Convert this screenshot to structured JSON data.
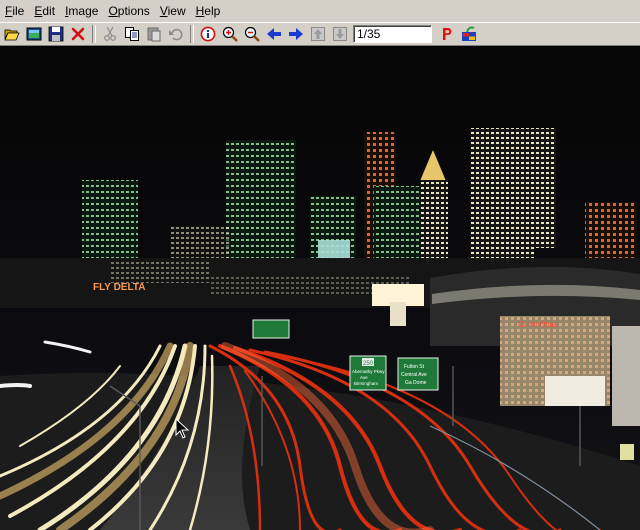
{
  "menu": {
    "file": {
      "accel": "F",
      "rest": "ile"
    },
    "edit": {
      "accel": "E",
      "rest": "dit"
    },
    "image": {
      "accel": "I",
      "rest": "mage"
    },
    "options": {
      "accel": "O",
      "rest": "ptions"
    },
    "view": {
      "accel": "V",
      "rest": "iew"
    },
    "help": {
      "accel": "H",
      "rest": "elp"
    }
  },
  "toolbar": {
    "counter": "1/35",
    "icons": [
      "open-folder-icon",
      "thumbnails-icon",
      "save-icon",
      "delete-icon",
      "cut-icon",
      "copy-icon",
      "paste-icon",
      "undo-icon",
      "info-icon",
      "zoom-in-icon",
      "zoom-out-icon",
      "previous-arrow-icon",
      "next-arrow-icon",
      "first-icon",
      "last-icon",
      "p-icon",
      "slideshow-icon"
    ]
  },
  "photo": {
    "signs": {
      "fly_delta": "FLY DELTA",
      "hotel_neon": "Omni Hotel",
      "exit_number": "250",
      "sign1_line1": "Abernathy Pkwy",
      "sign1_line2": "Ave",
      "sign1_line3": "Birmingham",
      "sign2_line1": "Fulton St",
      "sign2_line2": "Central Ave",
      "sign2_line3": "Ga Dome"
    }
  },
  "colors": {
    "chrome": "#d4d0c8",
    "viewer_bg": "#000000",
    "headlights": "#fff6c8",
    "taillights": "#e23010",
    "highway_sign": "#1f7a3a"
  }
}
